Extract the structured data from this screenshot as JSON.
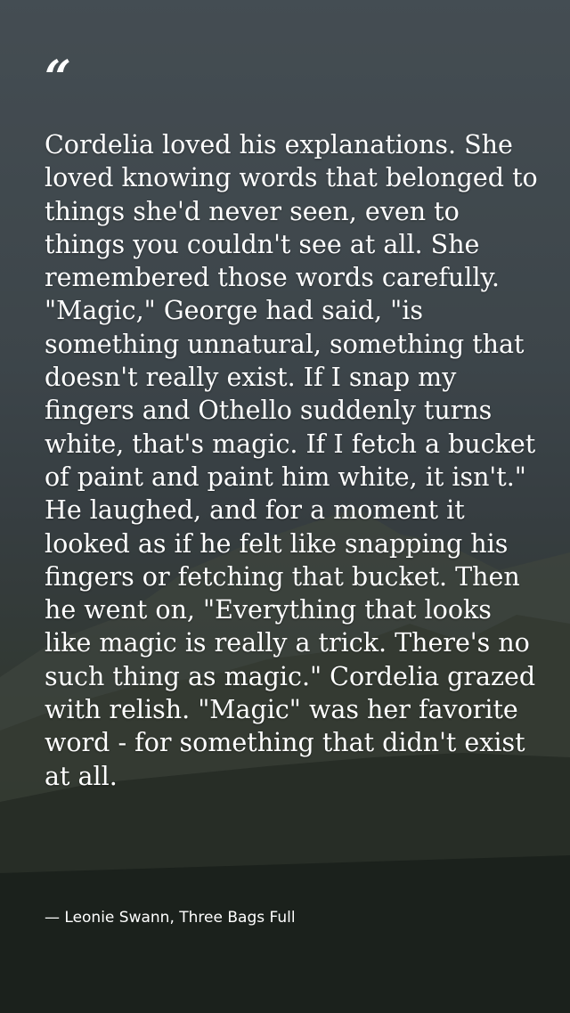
{
  "quote": {
    "mark": "“",
    "text": "Cordelia loved his explanations. She loved knowing words that belonged to things she'd never seen, even to things you couldn't see at all. She remembered those words carefully. \"Magic,\" George had said, \"is something unnatural, something that doesn't really exist. If I snap my fingers and Othello suddenly turns white, that's magic. If I fetch a bucket of paint and paint him white, it isn't.\" He laughed, and for a moment it looked as if he felt like snapping his fingers or fetching that bucket. Then he went on, \"Everything that looks like magic is really a trick. There's no such thing as magic.\" Cordelia grazed with relish. \"Magic\" was her favorite word - for something that didn't exist at all.",
    "attribution": "— Leonie Swann, Three Bags Full"
  },
  "colors": {
    "text": "#ffffff",
    "sky": "#5a636a",
    "mountain": "#4a4f44",
    "forest": "#1f2419"
  }
}
